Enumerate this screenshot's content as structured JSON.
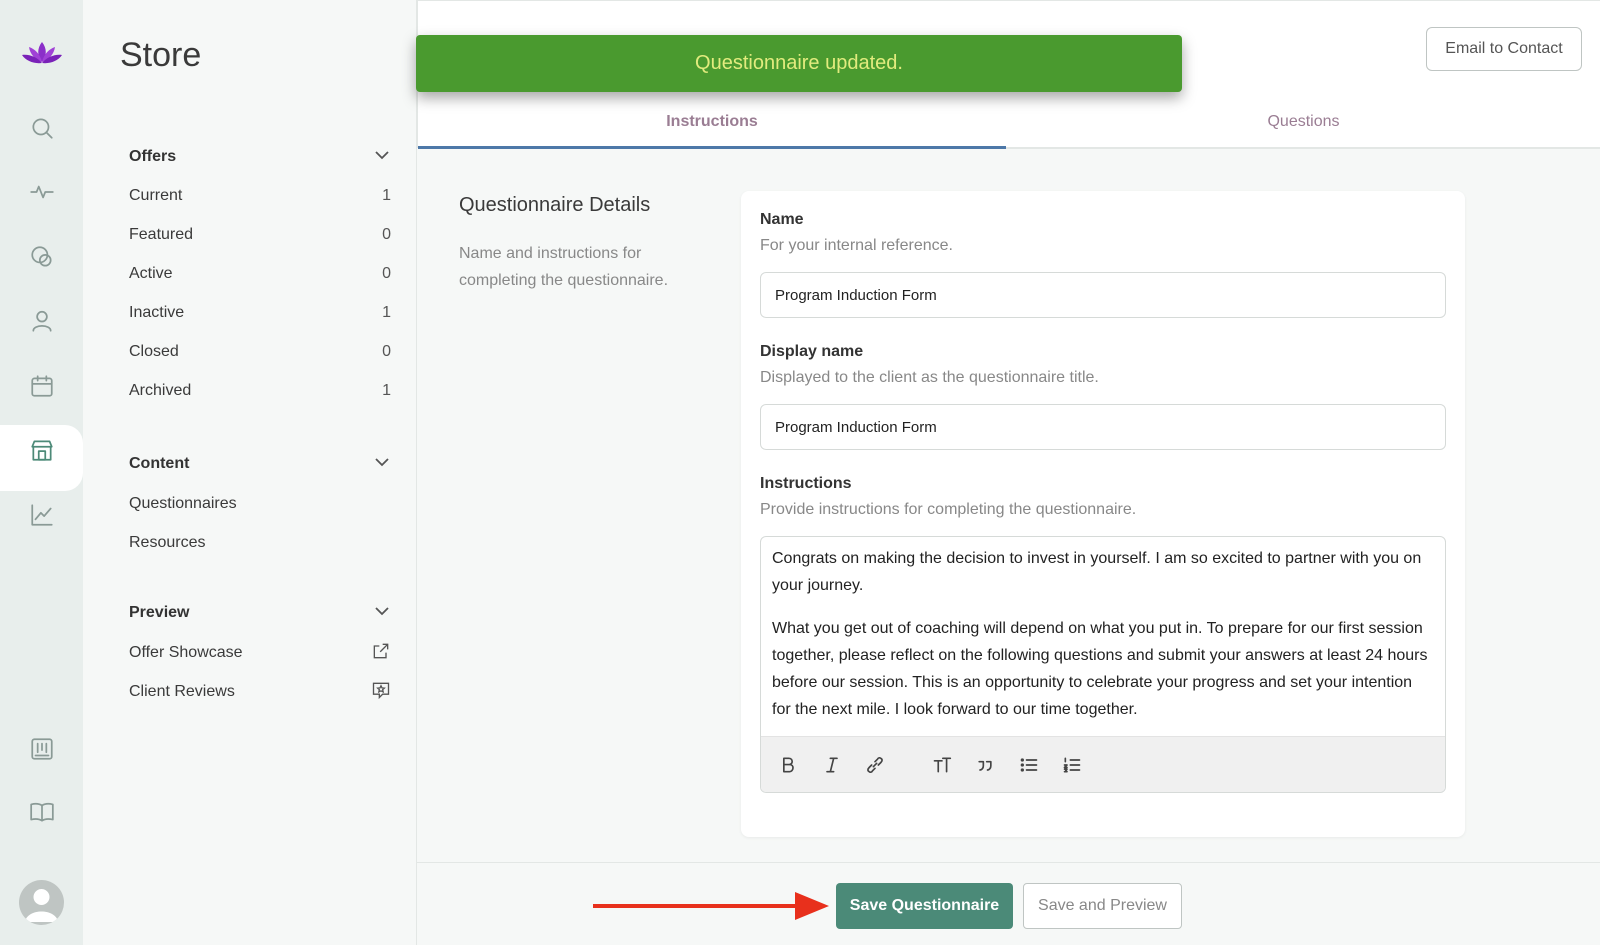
{
  "rail": {
    "icons": [
      "logo-lotus-icon",
      "search-icon",
      "activity-icon",
      "chat-icon",
      "user-icon",
      "calendar-icon",
      "store-icon",
      "chart-icon",
      "board-icon",
      "book-icon",
      "avatar"
    ]
  },
  "nav": {
    "title": "Store",
    "offers": {
      "heading": "Offers",
      "items": [
        {
          "label": "Current",
          "count": "1"
        },
        {
          "label": "Featured",
          "count": "0"
        },
        {
          "label": "Active",
          "count": "0"
        },
        {
          "label": "Inactive",
          "count": "1"
        },
        {
          "label": "Closed",
          "count": "0"
        },
        {
          "label": "Archived",
          "count": "1"
        }
      ]
    },
    "content": {
      "heading": "Content",
      "items": [
        {
          "label": "Questionnaires"
        },
        {
          "label": "Resources"
        }
      ]
    },
    "preview": {
      "heading": "Preview",
      "items": [
        {
          "label": "Offer Showcase",
          "icon": "external-link-icon"
        },
        {
          "label": "Client Reviews",
          "icon": "review-icon"
        }
      ]
    }
  },
  "header": {
    "email_button": "Email to Contact",
    "toast": "Questionnaire updated.",
    "tabs": [
      {
        "label": "Instructions",
        "active": true
      },
      {
        "label": "Questions",
        "active": false
      }
    ]
  },
  "details": {
    "heading": "Questionnaire Details",
    "description": "Name and instructions for completing the questionnaire."
  },
  "form": {
    "name": {
      "label": "Name",
      "help": "For your internal reference.",
      "value": "Program Induction Form"
    },
    "display_name": {
      "label": "Display name",
      "help": "Displayed to the client as the questionnaire title.",
      "value": "Program Induction Form"
    },
    "instructions": {
      "label": "Instructions",
      "help": "Provide instructions for completing the questionnaire.",
      "paragraph1": "Congrats on making the decision to invest in yourself. I am so excited to partner with you on your journey.",
      "paragraph2": "What you get out of coaching will depend on what you put in. To prepare for our first session together, please reflect on the following questions and submit your answers at least 24 hours before our session. This is an opportunity to celebrate your progress and set your intention for the next mile. I look forward to our time together.",
      "toolbar": [
        "bold-icon",
        "italic-icon",
        "link-icon",
        "heading-icon",
        "quote-icon",
        "bullet-list-icon",
        "numbered-list-icon"
      ]
    }
  },
  "footer": {
    "save_button": "Save Questionnaire",
    "preview_button": "Save and Preview"
  },
  "colors": {
    "accent": "#4b8a78",
    "toast_bg": "#4a9a2f",
    "toast_text": "#e2eb7e",
    "annotation_arrow": "#e8301c"
  }
}
